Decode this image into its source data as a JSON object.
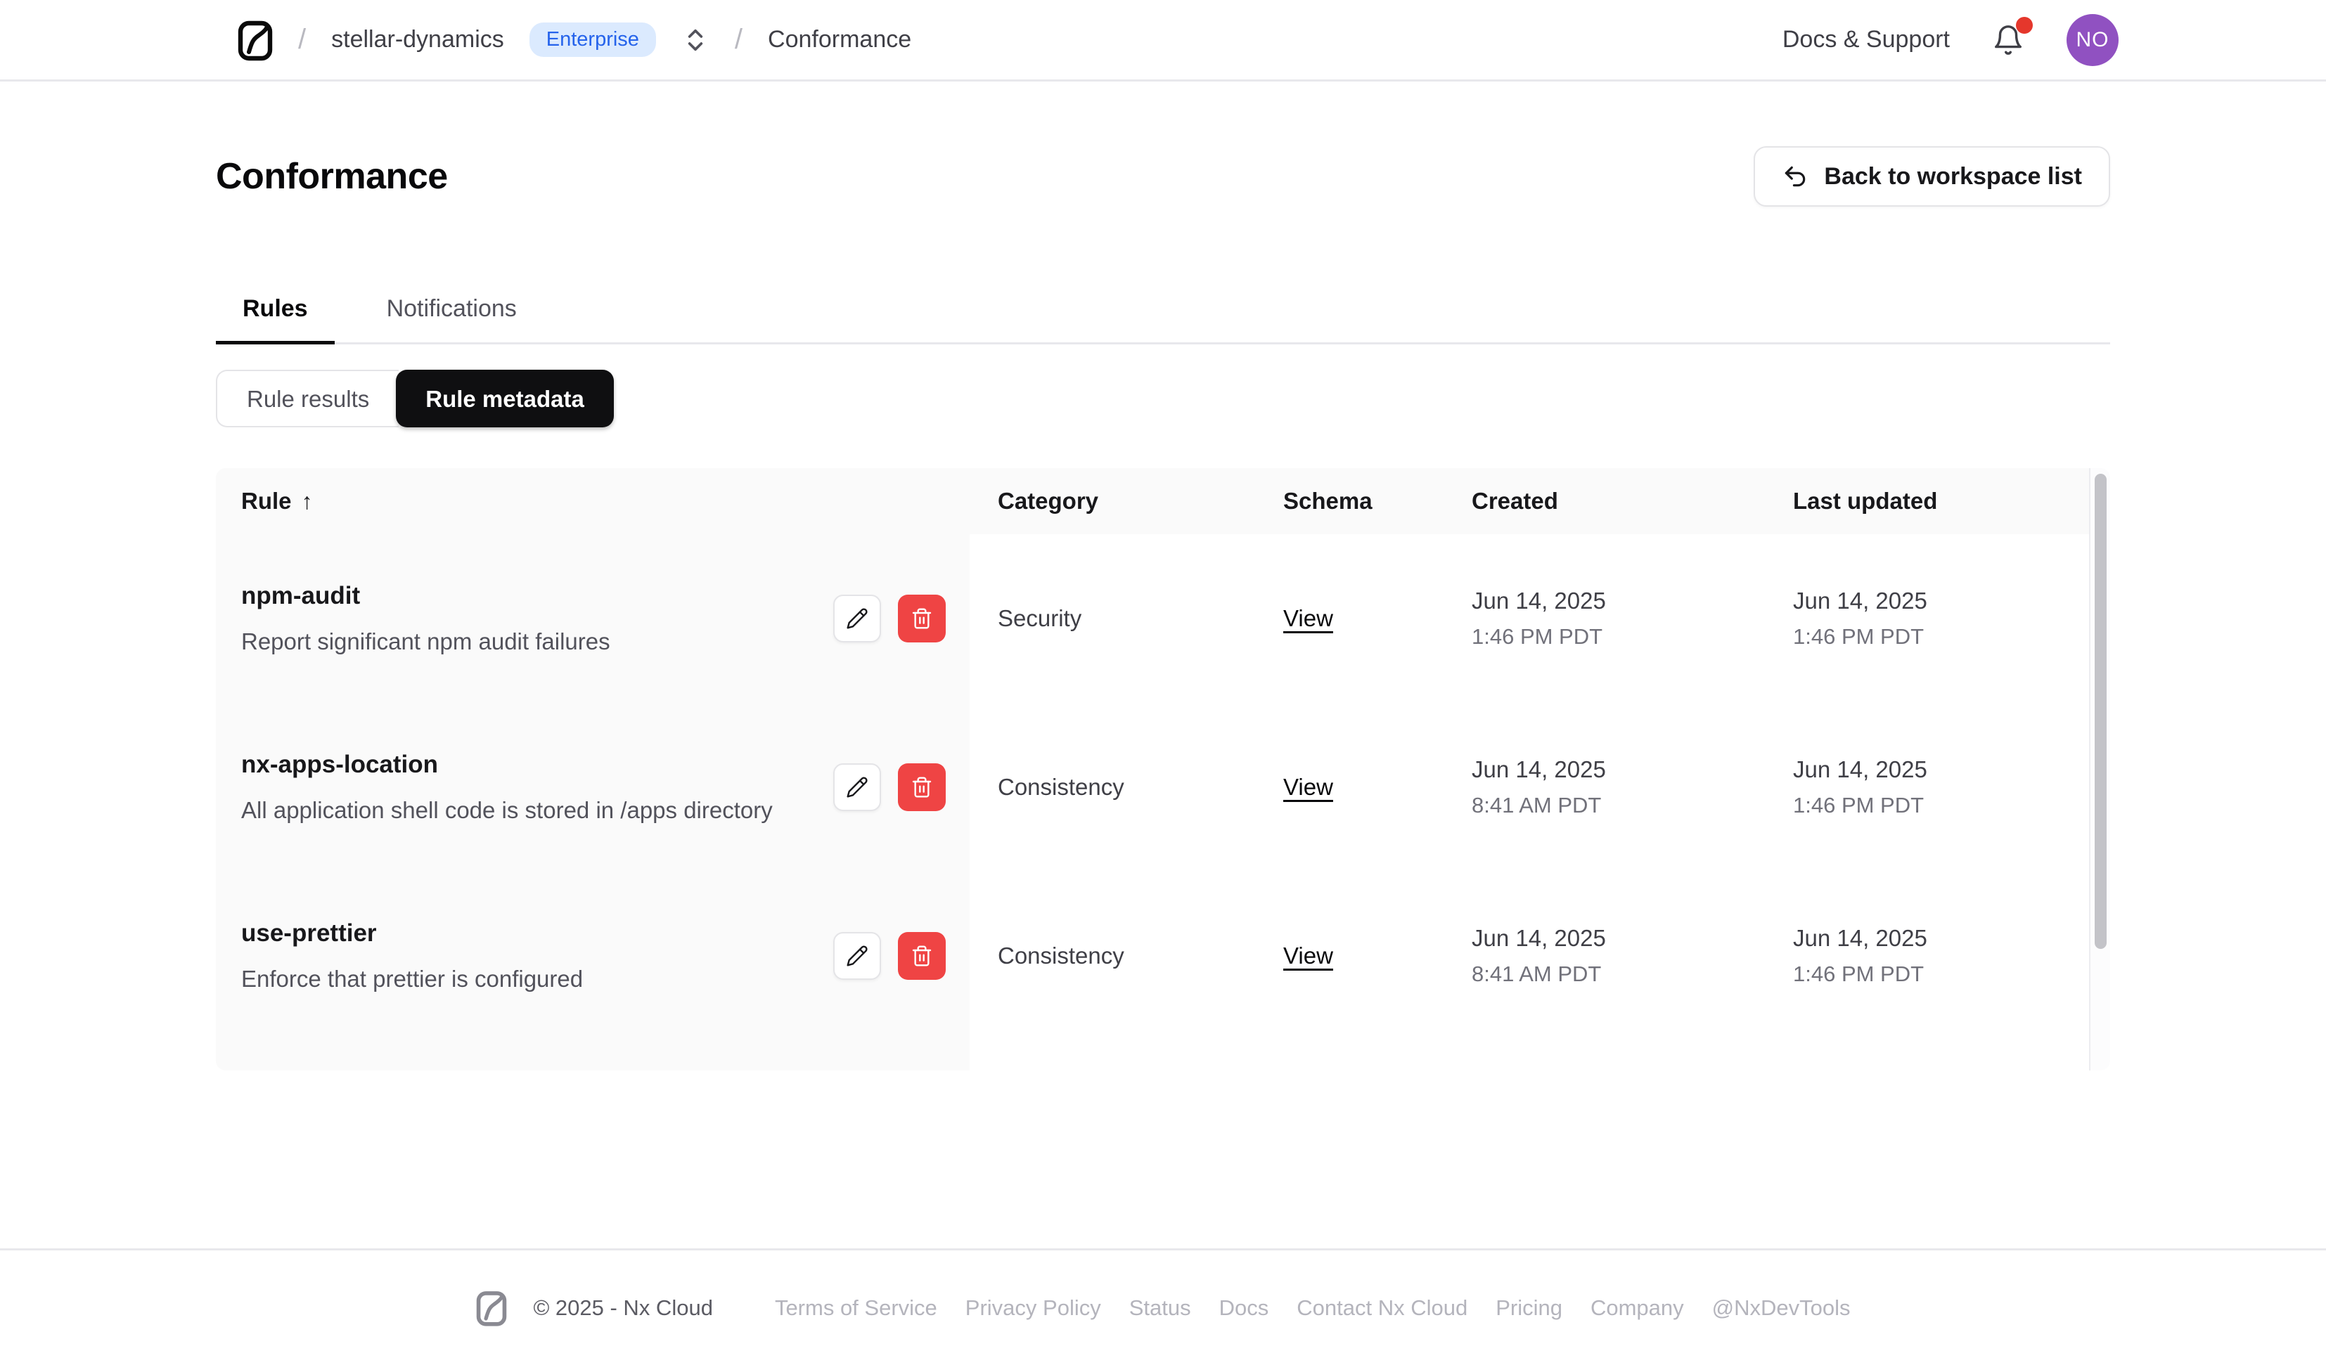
{
  "header": {
    "breadcrumb": {
      "workspace": "stellar-dynamics",
      "badge": "Enterprise",
      "separator": "/",
      "page": "Conformance"
    },
    "docs_support": "Docs & Support",
    "avatar_initials": "NO"
  },
  "page": {
    "title": "Conformance",
    "back_button": "Back to workspace list"
  },
  "tabs": [
    {
      "label": "Rules",
      "active": true
    },
    {
      "label": "Notifications",
      "active": false
    }
  ],
  "segmented": [
    {
      "label": "Rule results",
      "active": false
    },
    {
      "label": "Rule metadata",
      "active": true
    }
  ],
  "table": {
    "columns": [
      "Rule",
      "Category",
      "Schema",
      "Created",
      "Last updated"
    ],
    "sort_column": "Rule",
    "sort_indicator": "↑",
    "rows": [
      {
        "name": "npm-audit",
        "description": "Report significant npm audit failures",
        "category": "Security",
        "schema_label": "View",
        "created_date": "Jun 14, 2025",
        "created_time": "1:46 PM PDT",
        "updated_date": "Jun 14, 2025",
        "updated_time": "1:46 PM PDT"
      },
      {
        "name": "nx-apps-location",
        "description": "All application shell code is stored in /apps directory",
        "category": "Consistency",
        "schema_label": "View",
        "created_date": "Jun 14, 2025",
        "created_time": "8:41 AM PDT",
        "updated_date": "Jun 14, 2025",
        "updated_time": "1:46 PM PDT"
      },
      {
        "name": "use-prettier",
        "description": "Enforce that prettier is configured",
        "category": "Consistency",
        "schema_label": "View",
        "created_date": "Jun 14, 2025",
        "created_time": "8:41 AM PDT",
        "updated_date": "Jun 14, 2025",
        "updated_time": "1:46 PM PDT"
      }
    ]
  },
  "footer": {
    "copyright": "© 2025 - Nx Cloud",
    "links": [
      "Terms of Service",
      "Privacy Policy",
      "Status",
      "Docs",
      "Contact Nx Cloud",
      "Pricing",
      "Company",
      "@NxDevTools"
    ]
  },
  "colors": {
    "accent_blue": "#2563eb",
    "badge_bg": "#dbeafe",
    "delete_red": "#ef4444",
    "avatar_purple": "#9051c1",
    "notification_dot": "#e5372c",
    "active_toggle_bg": "#0f0f11",
    "table_header_bg": "#fafafa"
  }
}
